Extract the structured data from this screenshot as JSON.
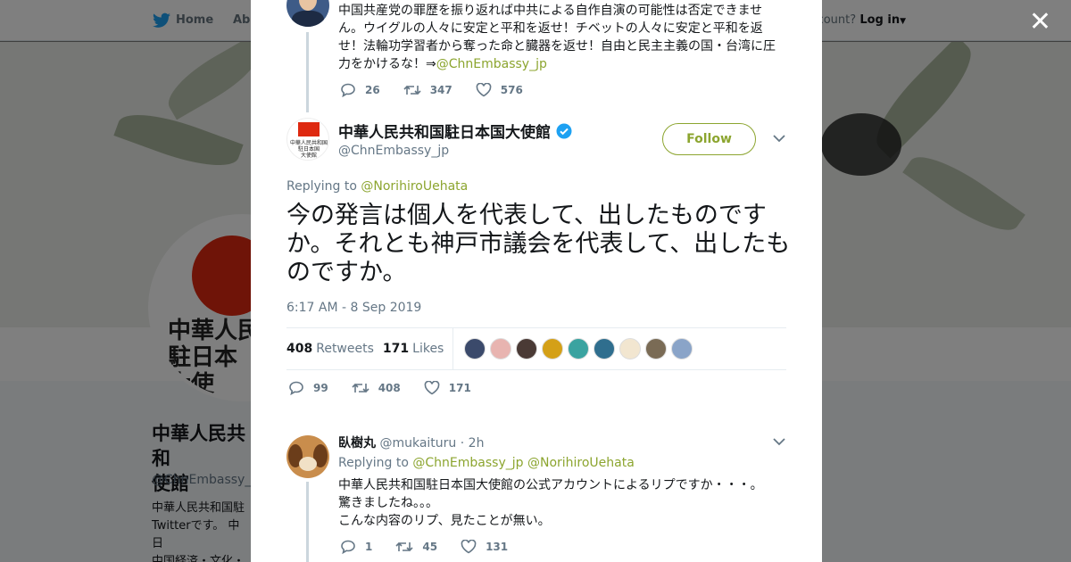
{
  "nav": {
    "home_label": "Home",
    "about_label": "Abo",
    "account_prompt": "ccount?",
    "login_label": "Log in"
  },
  "profile": {
    "avatar_text": "中華人民\n駐日本\n大使",
    "name": "中華人民共和\n使館",
    "handle": "@ChnEmbassy_jp",
    "bio": "中華人民共和国駐\nTwitterです。 中日\n中国経済・文化・\nどを皆様にご紹介"
  },
  "previous_tweet": {
    "text": "中国共産党の罪歴を振り返れば中共による自作自演の可能性は否定できません。ウイグルの人々に安定と平和を返せ！チベットの人々に安定と平和を返せ！法輪功学習者から奪った命と臓器を返せ！自由と民主主義の国・台湾に圧力をかけるな！⇒",
    "mention": "@ChnEmbassy_jp",
    "replies": "26",
    "retweets": "347",
    "likes": "576"
  },
  "main_tweet": {
    "avatar_caption": "中華人民共和国\n駐日本国\n大使館",
    "name": "中華人民共和国駐日本国大使館",
    "handle": "@ChnEmbassy_jp",
    "follow_label": "Follow",
    "replying_prefix": "Replying to",
    "replying_to": "@NorihiroUehata",
    "text": "今の発言は個人を代表して、出したものですか。それとも神戸市議会を代表して、出したものですか。",
    "timestamp": "6:17 AM - 8 Sep 2019",
    "retweet_count": "408",
    "retweet_label": "Retweets",
    "like_count": "171",
    "like_label": "Likes",
    "replies": "99",
    "retweets": "408",
    "likes": "171"
  },
  "likers_colors": [
    "#3b4a6b",
    "#e8b4b0",
    "#4a3a35",
    "#d4a017",
    "#3aa3a0",
    "#2f6e8e",
    "#f2e6d0",
    "#7a6b55",
    "#8aa4c8"
  ],
  "reply_tweet": {
    "name": "臥樹丸",
    "handle": "@mukaituru",
    "time": "2h",
    "replying_prefix": "Replying to",
    "replying_to_1": "@ChnEmbassy_jp",
    "replying_to_2": "@NorihiroUehata",
    "text_line1": "中華人民共和国駐日本国大使館の公式アカウントによるリプですか・・・。",
    "text_line2": "驚きましたね。。。",
    "text_line3": "こんな内容のリプ、見たことが無い。",
    "replies": "1",
    "retweets": "45",
    "likes": "131"
  },
  "colors": {
    "accent": "#8ca52f",
    "twitter_blue": "#1da1f2",
    "text_primary": "#14171a",
    "text_secondary": "#657786"
  },
  "close_icon": "close-icon"
}
